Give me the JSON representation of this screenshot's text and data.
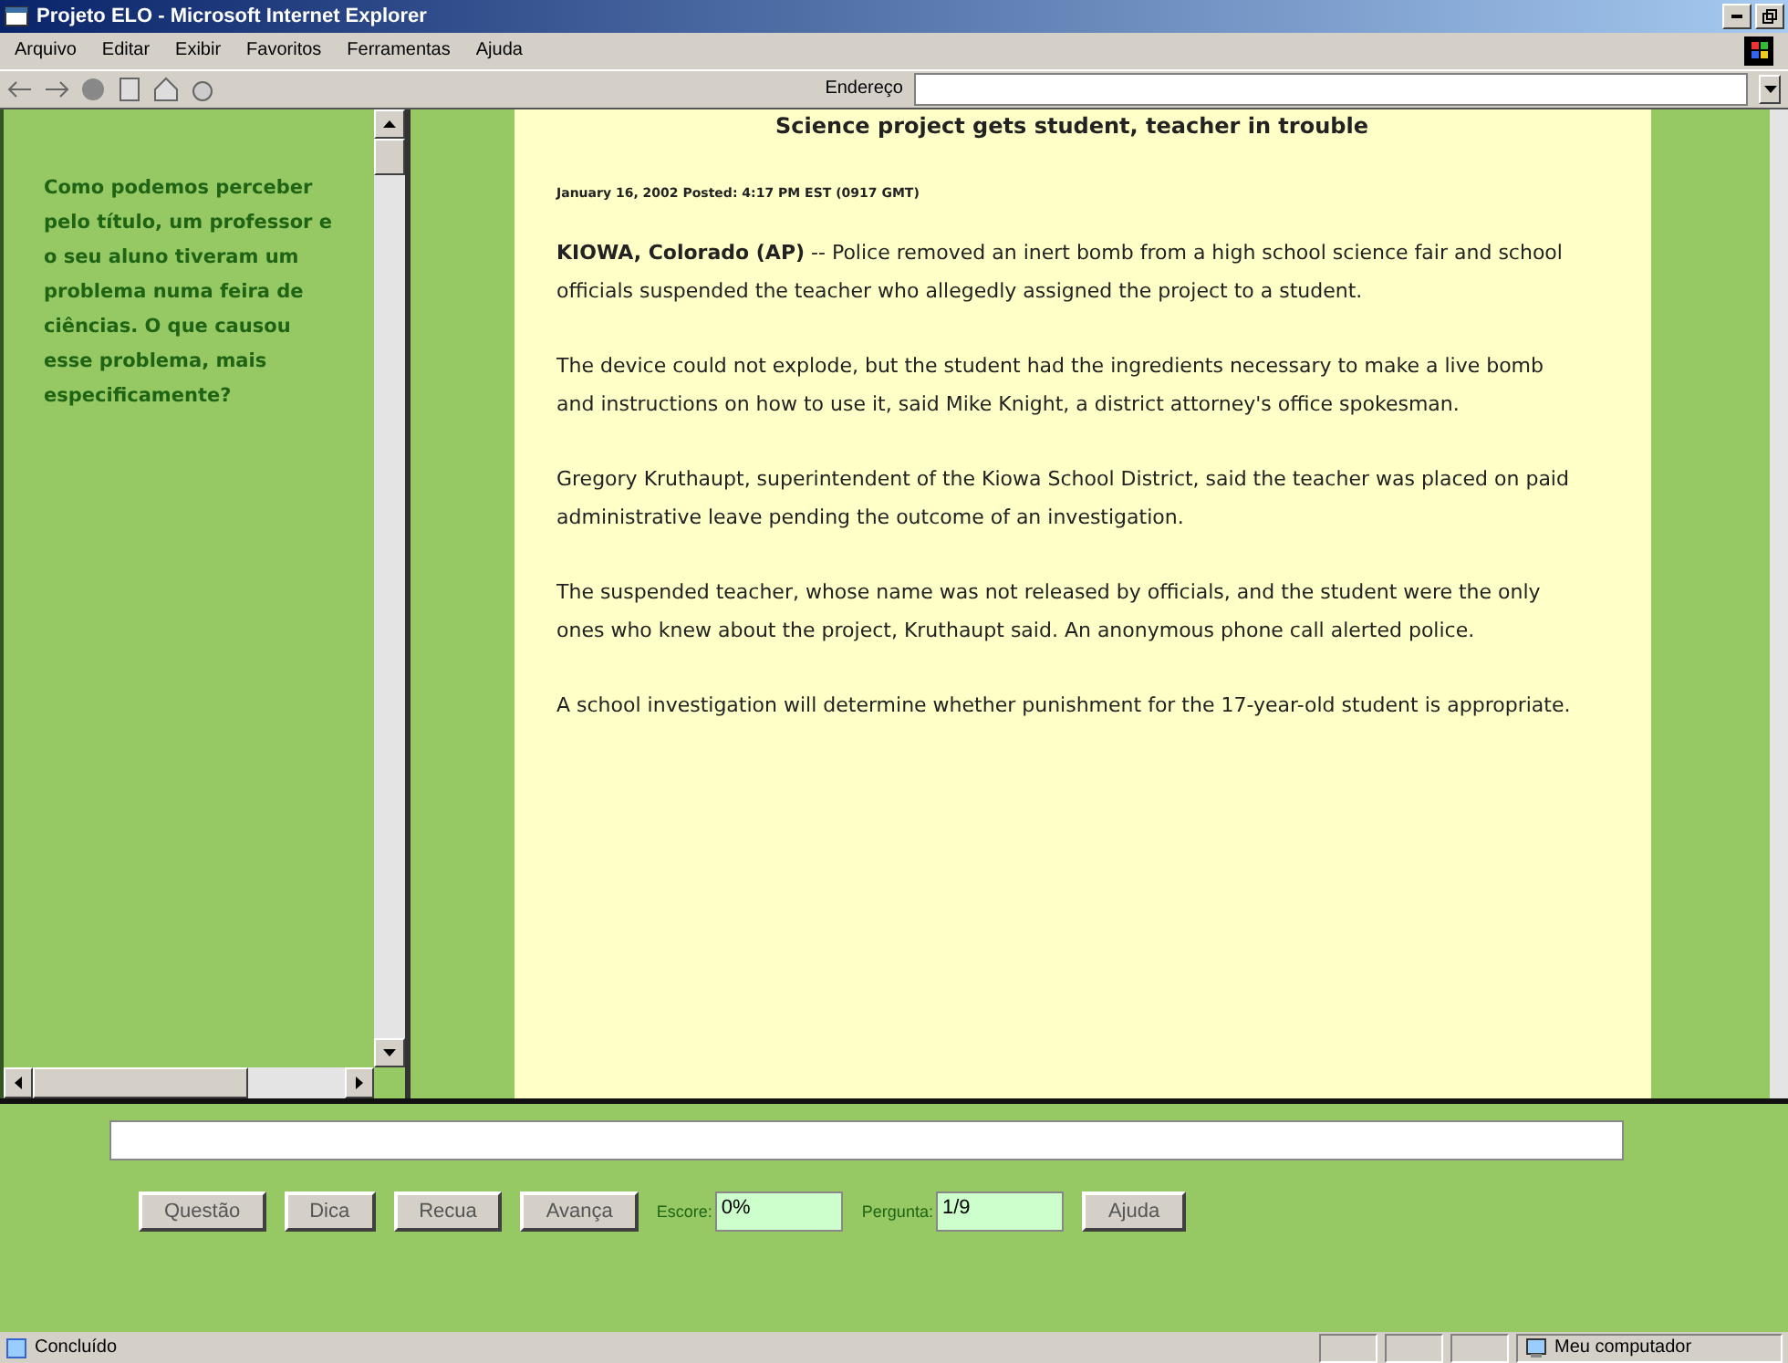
{
  "window": {
    "title": "Projeto ELO - Microsoft Internet Explorer"
  },
  "menu": [
    "Arquivo",
    "Editar",
    "Exibir",
    "Favoritos",
    "Ferramentas",
    "Ajuda"
  ],
  "address": {
    "label": "Endereço"
  },
  "question": "Como podemos perceber pelo título, um professor e o seu aluno tiveram um problema numa feira de ciências. O que causou esse problema, mais especificamente?",
  "article": {
    "headline": "Science project gets student, teacher in trouble",
    "dateline": "January 16, 2002 Posted: 4:17 PM EST (0917 GMT)",
    "paragraphs": [
      "**KIOWA, Colorado (AP)** -- Police removed an inert bomb from a high school science fair and school officials suspended the teacher who allegedly assigned the project to a student.",
      "The device could not explode, but the student had the ingredients necessary to make a live bomb and instructions on how to use it, said Mike Knight, a district attorney's office spokesman.",
      "Gregory Kruthaupt, superintendent of the Kiowa School District, said the teacher was placed on paid administrative leave pending the outcome of an investigation.",
      "The suspended teacher, whose name was not released by officials, and the student were the only ones who knew about the project, Kruthaupt said. An anonymous phone call alerted police.",
      "A school investigation will determine whether punishment for the 17-year-old student is appropriate."
    ]
  },
  "controls": [
    {
      "kind": "button",
      "label": "Questão"
    },
    {
      "kind": "button",
      "label": "Dica"
    },
    {
      "kind": "button",
      "label": "Recua"
    },
    {
      "kind": "button",
      "label": "Avança"
    },
    {
      "kind": "field",
      "label": "Escore:",
      "value": "0%"
    },
    {
      "kind": "field",
      "label": "Pergunta:",
      "value": "1/9"
    },
    {
      "kind": "button",
      "label": "Ajuda"
    }
  ],
  "status_bar": {
    "text": "Concluído",
    "zone": "Meu computador"
  }
}
